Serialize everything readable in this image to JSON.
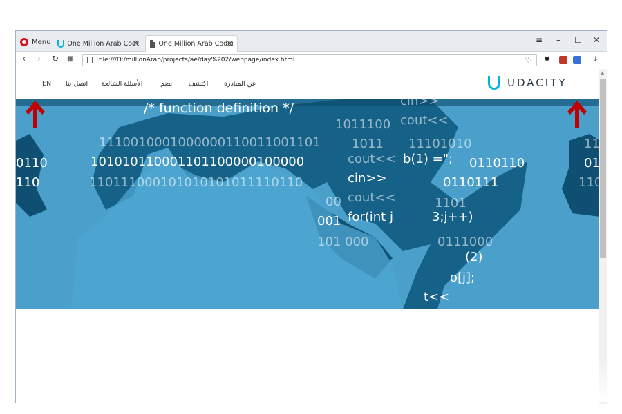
{
  "browser": {
    "menu_label": "Menu",
    "tabs": [
      {
        "title": "One Million Arab Coders",
        "active": false
      },
      {
        "title": "One Million Arab Coders",
        "active": true
      }
    ],
    "url": "file:///D:/millionArab/projects/ae/day%202/webpage/index.html"
  },
  "site": {
    "logo_text": "UDACITY",
    "nav": [
      "عن المبادرة",
      "اكتشف",
      "انضم",
      "الأسئلة الشائعة",
      "اتصل بنا",
      "EN"
    ]
  },
  "hero": {
    "code_lines": [
      "/*  function definition  */",
      "cin>>",
      "cout<<",
      "1011100",
      "1011",
      "11101010",
      "cout<<",
      "b(1) =\";",
      "cin>>",
      "cout<<",
      "for(int j",
      "3;j++)",
      "0110110",
      "0110111",
      "1101",
      "(2)",
      "t<<",
      "o[j];"
    ],
    "binary_lines": [
      "1110010001000000110011001101",
      "101010110001101100000100000",
      "110111000101010101011110110",
      "00",
      "001",
      "101 000",
      "0110",
      "110",
      "0111000",
      "11",
      "01",
      "110"
    ],
    "arrow_color": "#c00000"
  }
}
